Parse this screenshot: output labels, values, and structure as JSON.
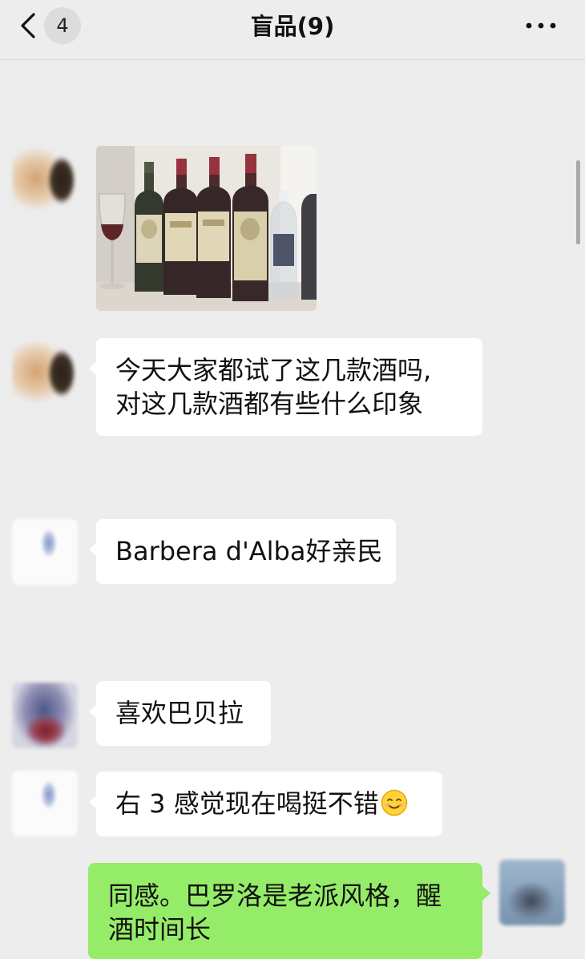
{
  "header": {
    "back_icon": "chevron-left-icon",
    "unread_count": "4",
    "title": "盲品(9)",
    "more_icon": "more-dots-icon"
  },
  "messages": [
    {
      "type": "image",
      "sender": "left",
      "alt": "wine-bottles-photo"
    },
    {
      "type": "text",
      "sender": "left",
      "lines": [
        "今天大家都试了这几款酒吗,",
        "对这几款酒都有些什么印象"
      ]
    },
    {
      "type": "text",
      "sender": "left",
      "lines": [
        "Barbera d'Alba好亲民"
      ]
    },
    {
      "type": "text",
      "sender": "left",
      "lines": [
        "喜欢巴贝拉"
      ]
    },
    {
      "type": "text",
      "sender": "left",
      "lines": [
        "右 3 感觉现在喝挺不错"
      ],
      "emoji": "smiling-face-icon"
    },
    {
      "type": "text",
      "sender": "me",
      "lines": [
        "同感。巴罗洛是老派风格，醒",
        "酒时间长"
      ]
    }
  ],
  "colors": {
    "background": "#ededed",
    "bubble_incoming": "#ffffff",
    "bubble_outgoing": "#95ec69"
  }
}
